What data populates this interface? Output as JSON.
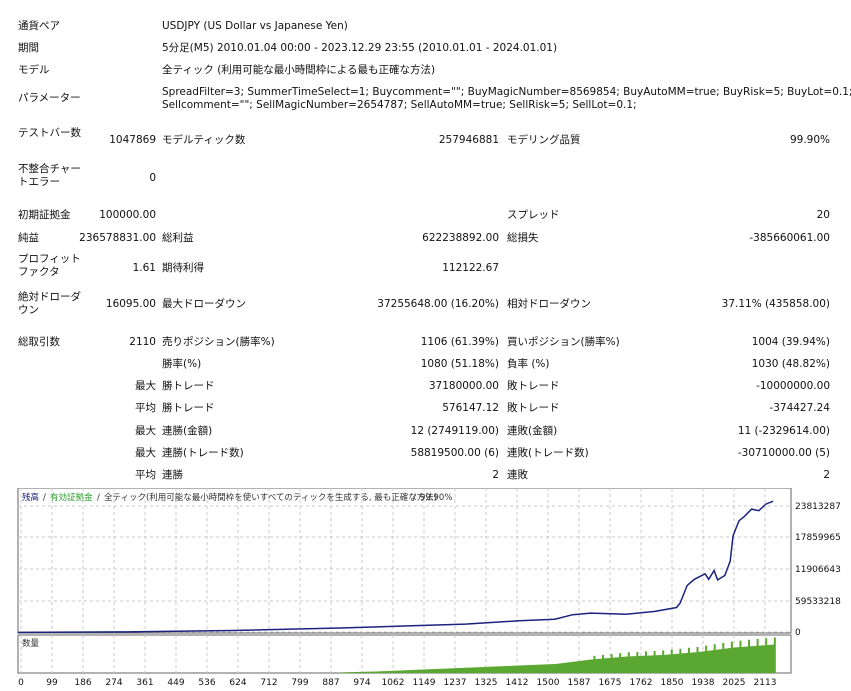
{
  "report": {
    "symbol_label": "通貨ペア",
    "symbol_value": "USDJPY (US Dollar vs Japanese Yen)",
    "period_label": "期間",
    "period_value": "5分足(M5) 2010.01.04 00:00 - 2023.12.29 23:55 (2010.01.01 - 2024.01.01)",
    "model_label": "モデル",
    "model_value": "全ティック (利用可能な最小時間枠による最も正確な方法)",
    "params_label": "パラメーター",
    "params_line1": "SpreadFilter=3; SummerTimeSelect=1; Buycomment=\"\"; BuyMagicNumber=8569854; BuyAutoMM=true; BuyRisk=5; BuyLot=0.1;",
    "params_line2": "Sellcomment=\"\"; SellMagicNumber=2654787; SellAutoMM=true; SellRisk=5; SellLot=0.1;",
    "bars_label": "テストバー数",
    "bars_value": "1047869",
    "model_ticks_label": "モデルティック数",
    "model_ticks_value": "257946881",
    "model_quality_label": "モデリング品質",
    "model_quality_value": "99.90%",
    "mismatch_label": "不整合チャートエラー",
    "mismatch_value": "0",
    "deposit_label": "初期証拠金",
    "deposit_value": "100000.00",
    "spread_label": "スプレッド",
    "spread_value": "20",
    "net_label": "純益",
    "net_value": "236578831.00",
    "gross_profit_label": "総利益",
    "gross_profit_value": "622238892.00",
    "gross_loss_label": "総損失",
    "gross_loss_value": "-385660061.00",
    "pf_label": "プロフィットファクタ",
    "pf_value": "1.61",
    "expected_label": "期待利得",
    "expected_value": "112122.67",
    "abs_dd_label": "絶対ドローダウン",
    "abs_dd_value": "16095.00",
    "max_dd_label": "最大ドローダウン",
    "max_dd_value": "37255648.00 (16.20%)",
    "rel_dd_label": "相対ドローダウン",
    "rel_dd_value": "37.11% (435858.00)",
    "trades_label": "総取引数",
    "trades_value": "2110",
    "short_label": "売りポジション(勝率%)",
    "short_value": "1106 (61.39%)",
    "long_label": "買いポジション(勝率%)",
    "long_value": "1004 (39.94%)",
    "win_pct_label": "勝率(%)",
    "win_pct_value": "1080 (51.18%)",
    "loss_pct_label": "負率 (%)",
    "loss_pct_value": "1030 (48.82%)",
    "max_word": "最大",
    "avg_word": "平均",
    "largest_win_label": "勝トレード",
    "largest_win_value": "37180000.00",
    "largest_loss_label": "敗トレード",
    "largest_loss_value": "-10000000.00",
    "avg_win_label": "勝トレード",
    "avg_win_value": "576147.12",
    "avg_loss_label": "敗トレード",
    "avg_loss_value": "-374427.24",
    "max_consec_win_amt_label": "連勝(金額)",
    "max_consec_win_amt_value": "12 (2749119.00)",
    "max_consec_loss_amt_label": "連敗(金額)",
    "max_consec_loss_amt_value": "11 (-2329614.00)",
    "max_consec_profit_label": "連勝(トレード数)",
    "max_consec_profit_value": "58819500.00 (6)",
    "max_consec_loss_label": "連敗(トレード数)",
    "max_consec_loss_value": "-30710000.00 (5)",
    "avg_consec_win_label": "連勝",
    "avg_consec_win_value": "2",
    "avg_consec_loss_label": "連敗",
    "avg_consec_loss_value": "2"
  },
  "chart": {
    "legend_balance": "残高",
    "legend_sep": "/",
    "legend_equity": "有効証拠金",
    "legend_model": "全ティック(利用可能な最小時間枠を使いすべてのティックを生成する, 最も正確な方法)",
    "legend_quality": "99.90%",
    "volume_label": "数量",
    "colors": {
      "balance": "#1a237e",
      "volume": "#5aa832",
      "equity_text": "#2e9e2e",
      "grid": "#c8c8c8"
    }
  },
  "chart_data": {
    "type": "line",
    "y_ticks": [
      "23813287",
      "17859965",
      "11906643",
      "59533218",
      "0"
    ],
    "x_ticks": [
      "0",
      "99",
      "186",
      "274",
      "361",
      "449",
      "536",
      "624",
      "712",
      "799",
      "887",
      "974",
      "1062",
      "1149",
      "1237",
      "1325",
      "1412",
      "1500",
      "1587",
      "1675",
      "1762",
      "1850",
      "1938",
      "2025",
      "2113"
    ],
    "balance": {
      "x": [
        0,
        300,
        600,
        900,
        1100,
        1250,
        1400,
        1500,
        1550,
        1600,
        1700,
        1780,
        1840,
        1850,
        1870,
        1890,
        1920,
        1930,
        1945,
        1955,
        1975,
        1990,
        1998,
        2005,
        2015,
        2030,
        2050,
        2070,
        2090,
        2110
      ],
      "y": [
        100000,
        200000,
        450000,
        900000,
        1300000,
        1600000,
        2200000,
        2500000,
        3300000,
        3600000,
        3400000,
        3900000,
        4600000,
        5400000,
        8600000,
        9700000,
        10700000,
        9700000,
        11300000,
        9600000,
        10400000,
        13000000,
        17500000,
        18700000,
        20300000,
        21100000,
        22400000,
        22100000,
        23300000,
        23813287
      ]
    },
    "volume": {
      "x": [
        900,
        1000,
        1100,
        1200,
        1300,
        1400,
        1500,
        1600,
        1700,
        1800,
        1900,
        2000,
        2113
      ],
      "y": [
        0.02,
        0.05,
        0.1,
        0.15,
        0.2,
        0.25,
        0.3,
        0.45,
        0.55,
        0.6,
        0.7,
        0.85,
        0.95
      ]
    }
  }
}
